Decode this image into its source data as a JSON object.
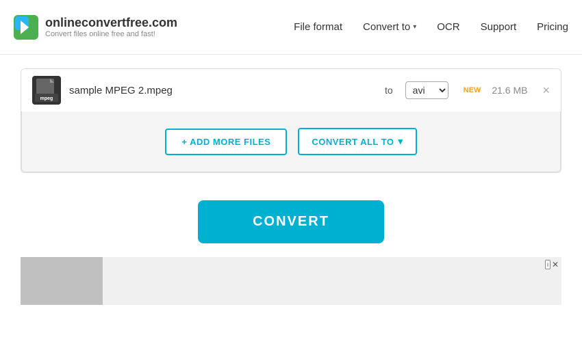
{
  "header": {
    "logo_title": "onlineconvertfree.com",
    "logo_subtitle": "Convert files online free and fast!",
    "nav": [
      {
        "id": "file-format",
        "label": "File format",
        "has_dropdown": false
      },
      {
        "id": "convert-to",
        "label": "Convert to",
        "has_dropdown": true
      },
      {
        "id": "ocr",
        "label": "OCR",
        "has_dropdown": false
      },
      {
        "id": "support",
        "label": "Support",
        "has_dropdown": false
      },
      {
        "id": "pricing",
        "label": "Pricing",
        "has_dropdown": false
      }
    ]
  },
  "file_row": {
    "file_name": "sample MPEG 2.mpeg",
    "to_label": "to",
    "format_value": "avi",
    "new_badge": "NEW",
    "file_size": "21.6 MB",
    "file_type": "mpeg"
  },
  "actions": {
    "add_files_label": "+ ADD MORE FILES",
    "convert_all_label": "CONVERT ALL TO",
    "convert_label": "CONVERT"
  },
  "ad": {
    "label": "i",
    "close": "✕"
  }
}
